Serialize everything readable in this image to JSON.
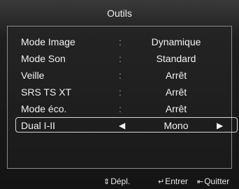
{
  "menu": {
    "title": "Outils",
    "items": [
      {
        "label": "Mode Image",
        "separator": ":",
        "value": "Dynamique"
      },
      {
        "label": "Mode Son",
        "separator": ":",
        "value": "Standard"
      },
      {
        "label": "Veille",
        "separator": ":",
        "value": "Arrêt"
      },
      {
        "label": "SRS TS XT",
        "separator": ":",
        "value": "Arrêt"
      },
      {
        "label": "Mode éco.",
        "separator": ":",
        "value": "Arrêt"
      },
      {
        "label": "Dual I-II",
        "value": "Mono",
        "selected": true,
        "left_arrow": "◀",
        "right_arrow": "▶"
      }
    ]
  },
  "footer": {
    "move": {
      "icon": "up-down-arrow-icon",
      "glyph": "⇕",
      "label": "Dépl."
    },
    "enter": {
      "icon": "enter-icon",
      "glyph": "↵",
      "label": "Entrer"
    },
    "exit": {
      "icon": "exit-icon",
      "glyph": "⇤",
      "label": "Quitter"
    }
  },
  "colors": {
    "background": "#141414",
    "text": "#f2f2f2",
    "border": "#8a8a8a",
    "selection_frame": "#d8d8d8"
  }
}
